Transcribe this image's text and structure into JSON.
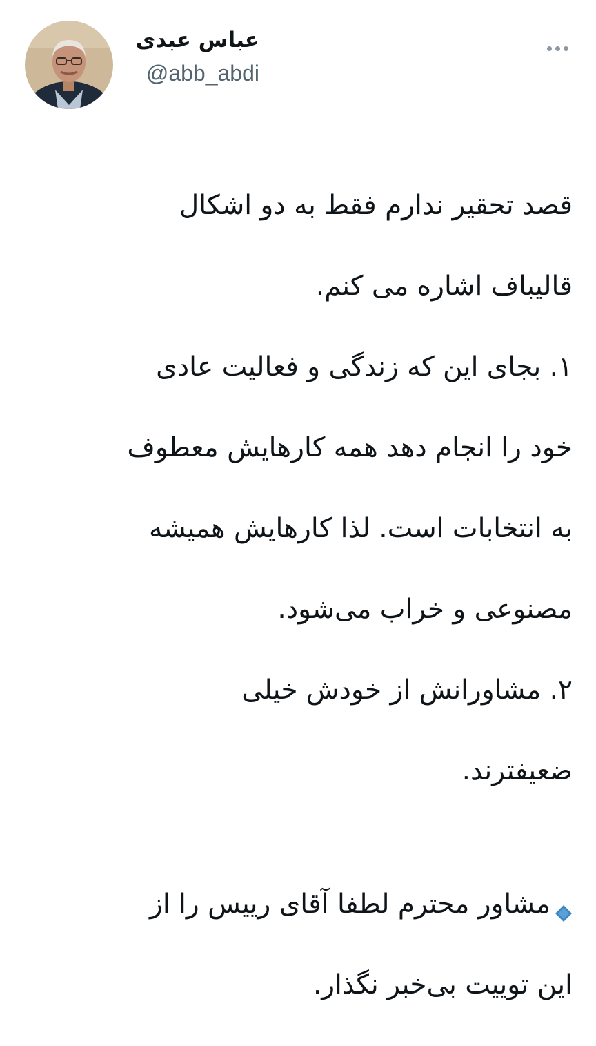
{
  "author": {
    "display_name": "عباس عبدی",
    "handle": "@abb_abdi",
    "avatar_icon": "profile-photo"
  },
  "more_icon": "more-horizontal-icon",
  "tweet": {
    "lines": [
      "قصد تحقیر ندارم فقط به دو اشکال",
      "قالیباف اشاره می کنم.",
      "۱. بجای این که زندگی و فعالیت عادی",
      "خود را انجام دهد همه کارهایش معطوف",
      "به انتخابات است. لذا کارهایش همیشه",
      "مصنوعی و خراب می‌شود.",
      "۲.  مشاورانش از خودش خیلی",
      "ضعیفترند."
    ],
    "reply_lines": [
      "مشاور محترم لطفا آقای رییس را از",
      "این توییت بی‌خبر نگذار."
    ],
    "reply_marker_icon": "blue-diamond-icon",
    "reply_marker_color": "#3b88c3"
  },
  "colors": {
    "text": "#0f1419",
    "secondary": "#536471",
    "more_dots": "#8b98a5"
  }
}
